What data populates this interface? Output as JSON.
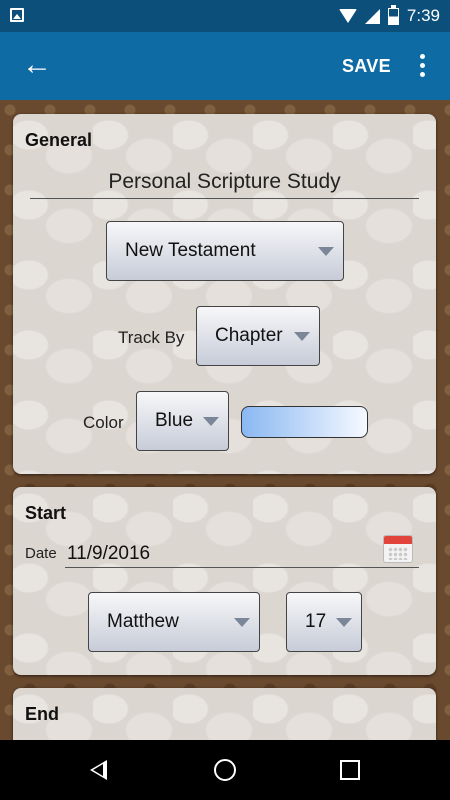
{
  "status_bar": {
    "time": "7:39"
  },
  "app_bar": {
    "save_label": "SAVE"
  },
  "general": {
    "title": "General",
    "plan_name": "Personal Scripture Study",
    "collection": "New Testament",
    "track_by_label": "Track By",
    "track_by_value": "Chapter",
    "color_label": "Color",
    "color_value": "Blue",
    "swatch_color": "#8ab8f2"
  },
  "start": {
    "title": "Start",
    "date_label": "Date",
    "date_value": "11/9/2016",
    "book": "Matthew",
    "chapter": "17"
  },
  "end": {
    "title": "End"
  },
  "icons": {
    "status_left": "image-icon",
    "wifi": "wifi-icon",
    "signal": "signal-icon",
    "battery": "battery-icon",
    "back": "arrow-back-icon",
    "overflow": "more-vert-icon",
    "calendar": "calendar-icon"
  },
  "colors": {
    "app_bar": "#0f6ba3",
    "status_bar": "#0b4f7a"
  }
}
